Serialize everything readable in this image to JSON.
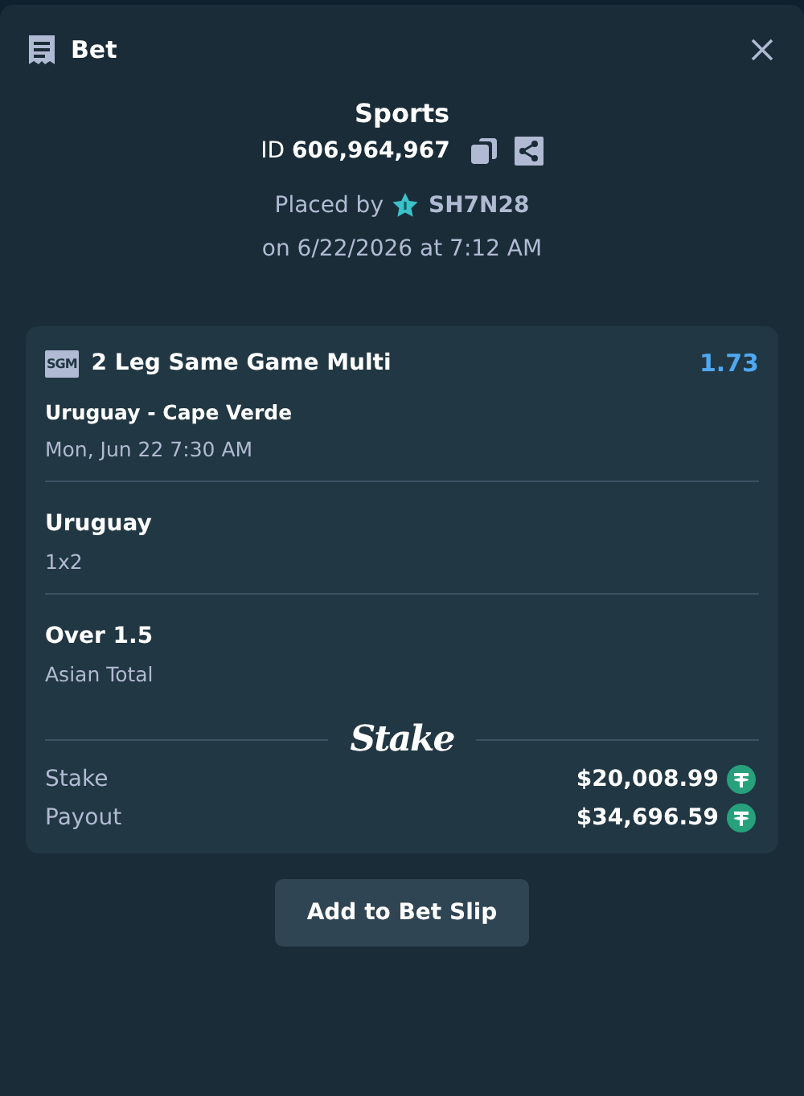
{
  "header": {
    "title": "Bet"
  },
  "summary": {
    "category": "Sports",
    "id_label": "ID",
    "id_value": "606,964,967",
    "placed_by_label": "Placed by",
    "user": "SH7N28",
    "placed_on": "on 6/22/2026 at 7:12 AM"
  },
  "bet": {
    "badge": "SGM",
    "title": "2 Leg Same Game Multi",
    "odds": "1.73",
    "event": "Uruguay - Cape Verde",
    "event_time": "Mon, Jun 22 7:30 AM",
    "legs": [
      {
        "selection": "Uruguay",
        "market": "1x2"
      },
      {
        "selection": "Over 1.5",
        "market": "Asian Total"
      }
    ],
    "brand": "Stake",
    "totals": [
      {
        "label": "Stake",
        "amount": "$20,008.99"
      },
      {
        "label": "Payout",
        "amount": "$34,696.59"
      }
    ]
  },
  "buttons": [
    "Add to Bet Slip"
  ]
}
